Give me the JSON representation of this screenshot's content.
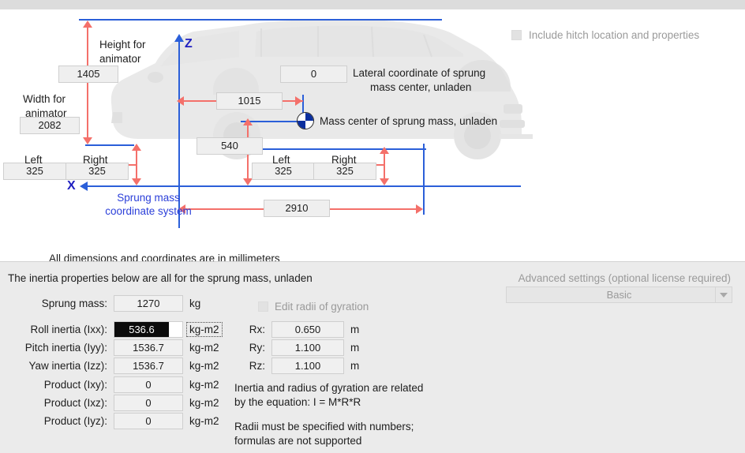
{
  "diagram": {
    "height_label_line1": "Height for",
    "height_label_line2": "animator",
    "height_value": "1405",
    "width_label_line1": "Width for",
    "width_label_line2": "animator",
    "width_value": "2082",
    "front_left_label": "Left",
    "front_left_value": "325",
    "front_right_label": "Right",
    "front_right_value": "325",
    "rear_left_label": "Left",
    "rear_left_value": "325",
    "rear_right_label": "Right",
    "rear_right_value": "325",
    "lateral_value": "0",
    "lateral_label_line1": "Lateral coordinate of sprung",
    "lateral_label_line2": "mass center, unladen",
    "longitudinal_value": "1015",
    "cg_height_value": "540",
    "wheelbase_value": "2910",
    "mass_center_label": "Mass center of sprung mass, unladen",
    "axis_z": "Z",
    "axis_x": "X",
    "coord_caption_line1": "Sprung mass",
    "coord_caption_line2": "coordinate system",
    "hitch_checkbox_label": "Include hitch location and properties",
    "units_note": "All dimensions and coordinates are in millimeters",
    "blue_color": "#2b5fd9",
    "red_color": "#f4706a"
  },
  "panel": {
    "heading": "The inertia properties below are all for the sprung mass, unladen",
    "advanced_title": "Advanced settings (optional license required)",
    "advanced_value": "Basic",
    "rows": [
      {
        "label": "Sprung mass:",
        "value": "1270",
        "unit": "kg"
      },
      {
        "label": "Roll inertia (Ixx):",
        "value": "536.6",
        "unit": "kg-m2"
      },
      {
        "label": "Pitch inertia (Iyy):",
        "value": "1536.7",
        "unit": "kg-m2"
      },
      {
        "label": "Yaw inertia (Izz):",
        "value": "1536.7",
        "unit": "kg-m2"
      },
      {
        "label": "Product (Ixy):",
        "value": "0",
        "unit": "kg-m2"
      },
      {
        "label": "Product (Ixz):",
        "value": "0",
        "unit": "kg-m2"
      },
      {
        "label": "Product (Iyz):",
        "value": "0",
        "unit": "kg-m2"
      }
    ],
    "radii_checkbox_label": "Edit radii of gyration",
    "radii": [
      {
        "label": "Rx:",
        "value": "0.650",
        "unit": "m"
      },
      {
        "label": "Ry:",
        "value": "1.100",
        "unit": "m"
      },
      {
        "label": "Rz:",
        "value": "1.100",
        "unit": "m"
      }
    ],
    "note1_line1": "Inertia and radius of gyration are related",
    "note1_line2": "by the equation: I = M*R*R",
    "note2_line1": "Radii must be specified with numbers;",
    "note2_line2": "formulas are not supported"
  }
}
